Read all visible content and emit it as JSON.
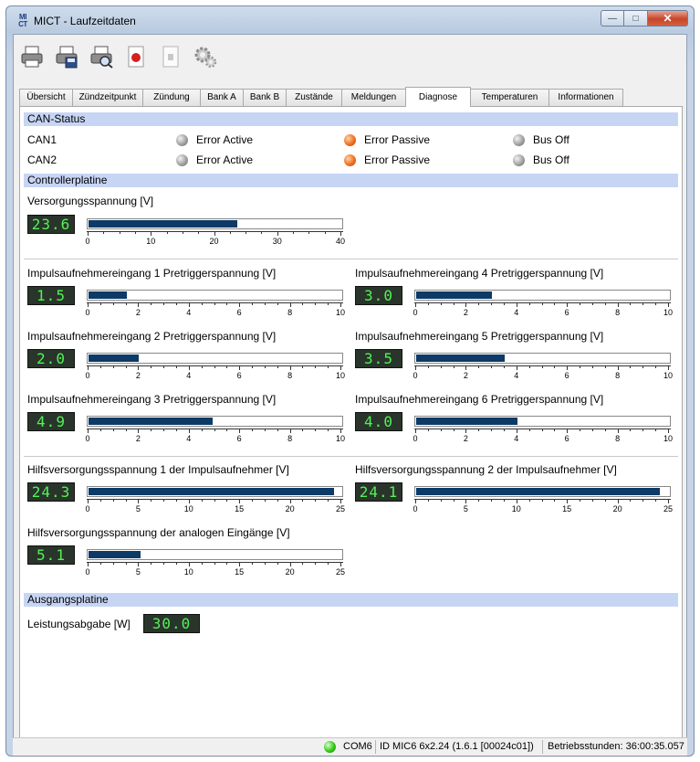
{
  "window": {
    "logo_text": "MI CT",
    "title": "MICT - Laufzeitdaten"
  },
  "toolbar": {
    "icons": [
      "printer-icon",
      "printer-save-icon",
      "print-preview-icon",
      "record-icon",
      "document-icon",
      "settings-gear-icon"
    ]
  },
  "tabs": [
    {
      "label": "Übersicht",
      "active": false
    },
    {
      "label": "Zündzeitpunkt",
      "active": false
    },
    {
      "label": "Zündung",
      "active": false
    },
    {
      "label": "Bank A",
      "active": false
    },
    {
      "label": "Bank B",
      "active": false
    },
    {
      "label": "Zustände",
      "active": false
    },
    {
      "label": "Meldungen",
      "active": false
    },
    {
      "label": "Diagnose",
      "active": true
    },
    {
      "label": "Temperaturen",
      "active": false
    },
    {
      "label": "Informationen",
      "active": false
    }
  ],
  "can_status": {
    "header": "CAN-Status",
    "rows": [
      {
        "name": "CAN1",
        "states": [
          {
            "label": "Error Active",
            "color": "grey"
          },
          {
            "label": "Error Passive",
            "color": "orange"
          },
          {
            "label": "Bus Off",
            "color": "grey"
          }
        ]
      },
      {
        "name": "CAN2",
        "states": [
          {
            "label": "Error Active",
            "color": "grey"
          },
          {
            "label": "Error Passive",
            "color": "orange"
          },
          {
            "label": "Bus Off",
            "color": "grey"
          }
        ]
      }
    ]
  },
  "controller": {
    "header": "Controllerplatine",
    "versorgung": {
      "title": "Versorgungsspannung [V]",
      "display": "23.6",
      "value": 23.6,
      "max": 40,
      "labels": [
        "0",
        "10",
        "20",
        "30",
        "40"
      ]
    },
    "impuls": [
      {
        "title": "Impulsaufnehmereingang 1 Pretriggerspannung [V]",
        "display": "1.5",
        "value": 1.5,
        "max": 10,
        "labels": [
          "0",
          "2",
          "4",
          "6",
          "8",
          "10"
        ]
      },
      {
        "title": "Impulsaufnehmereingang 4 Pretriggerspannung [V]",
        "display": "3.0",
        "value": 3.0,
        "max": 10,
        "labels": [
          "0",
          "2",
          "4",
          "6",
          "8",
          "10"
        ]
      },
      {
        "title": "Impulsaufnehmereingang 2 Pretriggerspannung [V]",
        "display": "2.0",
        "value": 2.0,
        "max": 10,
        "labels": [
          "0",
          "2",
          "4",
          "6",
          "8",
          "10"
        ]
      },
      {
        "title": "Impulsaufnehmereingang 5 Pretriggerspannung [V]",
        "display": "3.5",
        "value": 3.5,
        "max": 10,
        "labels": [
          "0",
          "2",
          "4",
          "6",
          "8",
          "10"
        ]
      },
      {
        "title": "Impulsaufnehmereingang 3 Pretriggerspannung [V]",
        "display": "4.9",
        "value": 4.9,
        "max": 10,
        "labels": [
          "0",
          "2",
          "4",
          "6",
          "8",
          "10"
        ]
      },
      {
        "title": "Impulsaufnehmereingang 6 Pretriggerspannung [V]",
        "display": "4.0",
        "value": 4.0,
        "max": 10,
        "labels": [
          "0",
          "2",
          "4",
          "6",
          "8",
          "10"
        ]
      }
    ],
    "hilfs": [
      {
        "title": "Hilfsversorgungsspannung 1 der Impulsaufnehmer [V]",
        "display": "24.3",
        "value": 24.3,
        "max": 25,
        "labels": [
          "0",
          "5",
          "10",
          "15",
          "20",
          "25"
        ]
      },
      {
        "title": "Hilfsversorgungsspannung 2 der Impulsaufnehmer [V]",
        "display": "24.1",
        "value": 24.1,
        "max": 25,
        "labels": [
          "0",
          "5",
          "10",
          "15",
          "20",
          "25"
        ]
      },
      {
        "title": "Hilfsversorgungsspannung der analogen Eingänge [V]",
        "display": "5.1",
        "value": 5.1,
        "max": 25,
        "labels": [
          "0",
          "5",
          "10",
          "15",
          "20",
          "25"
        ]
      }
    ]
  },
  "ausgang": {
    "header": "Ausgangsplatine",
    "leistung_label": "Leistungsabgabe [W]",
    "leistung_display": "30.0"
  },
  "statusbar": {
    "com": "COM6",
    "id": "ID MIC6 6x2.24 (1.6.1 [00024c01])",
    "hours": "Betriebsstunden: 36:00:35.057"
  }
}
